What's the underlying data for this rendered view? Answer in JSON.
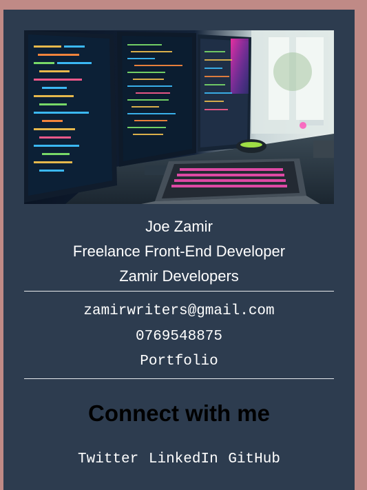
{
  "profile": {
    "name": "Joe Zamir",
    "role": "Freelance Front-End Developer",
    "company": "Zamir Developers"
  },
  "contact": {
    "email": "zamirwriters@gmail.com",
    "phone": "0769548875",
    "portfolio_label": "Portfolio"
  },
  "connect": {
    "heading": "Connect with me",
    "links": [
      "Twitter",
      "LinkedIn",
      "GitHub"
    ]
  },
  "colors": {
    "page_background": "#c08a86",
    "card_background": "#2d3c4f",
    "text": "#ffffff",
    "heading": "#000000",
    "divider": "#e9ecef"
  },
  "images": {
    "hero": "developer-workspace-photo"
  }
}
